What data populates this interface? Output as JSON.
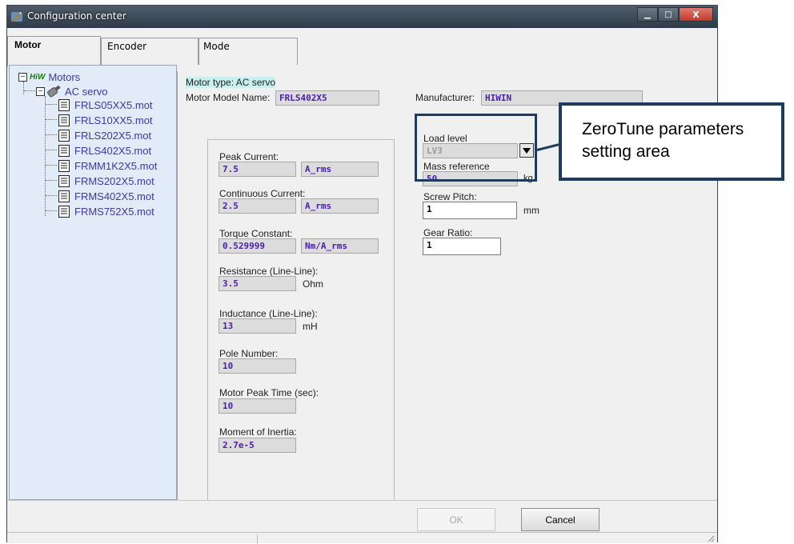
{
  "window": {
    "title": "Configuration center",
    "minimize_symbol": "▁",
    "maximize_symbol": "□",
    "close_symbol": "X"
  },
  "tabs": [
    {
      "label": "Motor",
      "active": true
    },
    {
      "label": "Encoder",
      "active": false
    },
    {
      "label": "Mode",
      "active": false
    }
  ],
  "tree": {
    "root_badge": "HiW",
    "root_label": "Motors",
    "group_label": "AC servo",
    "expand_symbol": "−",
    "items": [
      "FRLS05XX5.mot",
      "FRLS10XX5.mot",
      "FRLS202X5.mot",
      "FRLS402X5.mot",
      "FRMM1K2X5.mot",
      "FRMS202X5.mot",
      "FRMS402X5.mot",
      "FRMS752X5.mot"
    ]
  },
  "motor": {
    "type_label": "Motor type: AC servo",
    "model_label": "Motor Model Name:",
    "model_value": "FRLS402X5",
    "manufacturer_label": "Manufacturer:",
    "manufacturer_value": "HIWIN",
    "type_highlight_color": "#c9f0f0"
  },
  "params": {
    "peak_current": {
      "label": "Peak Current:",
      "value": "7.5",
      "unit": "A_rms"
    },
    "continuous_current": {
      "label": "Continuous Current:",
      "value": "2.5",
      "unit": "A_rms"
    },
    "torque_constant": {
      "label": "Torque Constant:",
      "value": "0.529999",
      "unit": "Nm/A_rms"
    },
    "resistance": {
      "label": "Resistance (Line-Line):",
      "value": "3.5",
      "unit": "Ohm"
    },
    "inductance": {
      "label": "Inductance (Line-Line):",
      "value": "13",
      "unit": "mH"
    },
    "pole_number": {
      "label": "Pole Number:",
      "value": "10"
    },
    "peak_time": {
      "label": "Motor Peak Time (sec):",
      "value": "10"
    },
    "inertia": {
      "label": "Moment of Inertia:",
      "value": "2.7e-5"
    }
  },
  "zerotune": {
    "load_level_label": "Load level",
    "load_level_value": "LV3",
    "mass_reference_label": "Mass reference",
    "mass_reference_value": "50",
    "mass_reference_unit": "kg",
    "screw_pitch_label": "Screw Pitch:",
    "screw_pitch_value": "1",
    "screw_pitch_unit": "mm",
    "gear_ratio_label": "Gear Ratio:",
    "gear_ratio_value": "1"
  },
  "buttons": {
    "ok": "OK",
    "cancel": "Cancel"
  },
  "callout": {
    "line1": "ZeroTune parameters",
    "line2": "setting area",
    "border_color": "#1f3a5c"
  },
  "colors": {
    "value_text": "#4b20a8",
    "tree_background": "#e2ecf8",
    "tree_item_text": "#3a3aa0"
  }
}
